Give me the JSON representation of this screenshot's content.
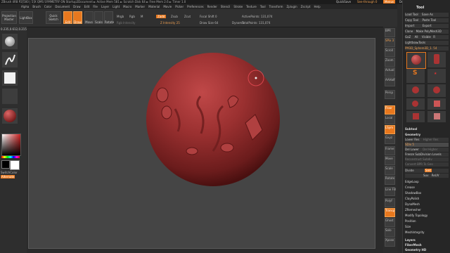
{
  "titlebar": {
    "text": "ZBrush 4R8  P2[500 | 5]X  QMS  SYMMETRY ON    Startup2Document  ► Active Mem 581  ► Scratch Disk 64  ► Free Mem 2.6  ► Timer 1.0",
    "quicksave": "QuickSave",
    "seethrough": "See-through 0",
    "menus": "Menus",
    "defaultzscript": "DefaultZScript"
  },
  "menu": [
    "Alpha",
    "Brush",
    "Color",
    "Document",
    "Draw",
    "Edit",
    "File",
    "Layer",
    "Light",
    "Macro",
    "Marker",
    "Material",
    "Movie",
    "Picker",
    "Preferences",
    "Render",
    "Stencil",
    "Stroke",
    "Texture",
    "Tool",
    "Transform",
    "Zplugin",
    "Zscript",
    "Help"
  ],
  "top": {
    "projection_master": "Projection Master",
    "lightbox": "LightBox",
    "quick_sketch": "Quick Sketch",
    "edit": "Edit",
    "draw": "Draw",
    "move": "Move",
    "scale": "Scale",
    "rotate": "Rotate",
    "mrgb": "Mrgb",
    "rgb": "Rgb",
    "m": "M",
    "zadd": "Zadd",
    "zsub": "Zsub",
    "zcut": "Zcut",
    "rgb_intensity": "Rgb Intensity",
    "z_intensity": "Z Intensity 25",
    "focal_shift": "Focal Shift 0",
    "draw_size": "Draw Size 64",
    "dynamic": "Dynamic",
    "active_points": "ActivePoints: 131,074",
    "total_points": "TotalPoints: 131,074"
  },
  "coords": "0.235,0.612,0.215",
  "left": {
    "switch_color": "SwitchColor",
    "alternate": "Alternate"
  },
  "rightshelf": [
    "BPR",
    "SPix 3",
    "Scroll",
    "Zoom",
    "Actual",
    "AAHalf",
    "Persp",
    "Floor",
    "Local",
    "LSym",
    "Gxyz",
    "Frame",
    "Move",
    "Scale",
    "Rotate",
    "Line Fill",
    "PolyF",
    "Transp",
    "Ghost",
    "Solo",
    "Xpose"
  ],
  "tray": {
    "title": "Tool",
    "load_tool": "Load Tool",
    "save_as": "Save As",
    "copy_tool": "Copy Tool",
    "paste_tool": "Paste Tool",
    "import": "Import",
    "export": "Export",
    "clone": "Clone",
    "make_polymesh": "Make PolyMesh3D",
    "goz": "GoZ",
    "all": "All",
    "visible": "Visible",
    "r": "R",
    "lightbox_tools": "Lightbox▸Tools",
    "current_tool": "PM3D_Sphere3D_1. 54",
    "tools": [
      "PM3D_Sphere3D",
      "Cylinder3D",
      "PolyMesh3D",
      "SimpleBrush",
      "EraserBrush",
      "Sphere3D",
      "Sphere3D_1",
      "Cube3D_1",
      "PM3D_Cube3D",
      "Cube3D_1"
    ],
    "subtool": "Subtool",
    "geometry": "Geometry",
    "lower_res": "Lower Res",
    "higher_res": "Higher Res",
    "sdiv": "SDiv 5",
    "del_lower": "Del Lower",
    "del_higher": "Del Higher",
    "freeze_subdiv": "Freeze SubDivision Levels",
    "reconstruct": "Reconstruct Subdiv",
    "convert_bpr": "Convert BPR To Geo",
    "divide": "Divide",
    "smt": "Smt",
    "suv": "Suv",
    "relax": "ReUV",
    "sections": [
      "EdgeLoop",
      "Crease",
      "ShadowBox",
      "ClayPolish",
      "DynaMesh",
      "ZRemesher",
      "Modify Topology",
      "Position",
      "Size",
      "MeshIntegrity"
    ],
    "layers": "Layers",
    "fibermesh": "FiberMesh",
    "geometry_hd": "Geometry HD"
  },
  "colors": {
    "accent": "#e8781e",
    "sphere": "#8b2a2a",
    "canvas": "#454545"
  }
}
